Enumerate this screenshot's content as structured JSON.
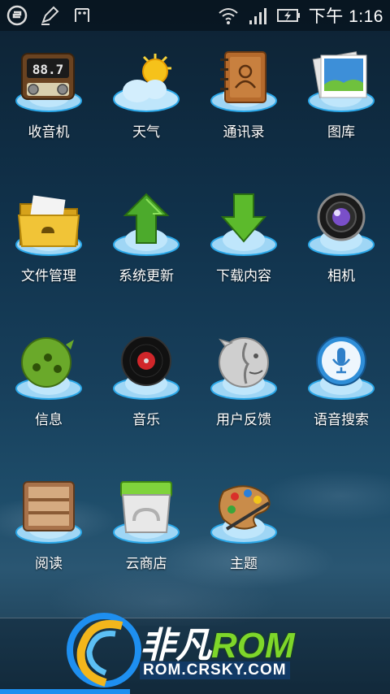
{
  "status_bar": {
    "time": "下午 1:16",
    "left_icons": [
      "app-logo-icon",
      "pen-icon",
      "usb-debug-icon"
    ],
    "right_icons": [
      "wifi-icon",
      "signal-icon",
      "battery-charging-icon"
    ]
  },
  "apps": [
    {
      "label": "收音机",
      "icon": "radio-icon"
    },
    {
      "label": "天气",
      "icon": "weather-icon"
    },
    {
      "label": "通讯录",
      "icon": "contacts-icon"
    },
    {
      "label": "图库",
      "icon": "gallery-icon"
    },
    {
      "label": "文件管理",
      "icon": "folder-icon"
    },
    {
      "label": "系统更新",
      "icon": "system-update-icon"
    },
    {
      "label": "下载内容",
      "icon": "download-icon"
    },
    {
      "label": "相机",
      "icon": "camera-icon"
    },
    {
      "label": "信息",
      "icon": "messaging-icon"
    },
    {
      "label": "音乐",
      "icon": "music-icon"
    },
    {
      "label": "用户反馈",
      "icon": "feedback-icon"
    },
    {
      "label": "语音搜索",
      "icon": "voice-search-icon"
    },
    {
      "label": "阅读",
      "icon": "reader-icon"
    },
    {
      "label": "云商店",
      "icon": "cloud-store-icon"
    },
    {
      "label": "主题",
      "icon": "theme-icon"
    }
  ],
  "radio_display": "88.7",
  "watermark": {
    "brand_cn": "非凡",
    "brand_en": "ROM",
    "url": "ROM.CRSKY.COM"
  }
}
